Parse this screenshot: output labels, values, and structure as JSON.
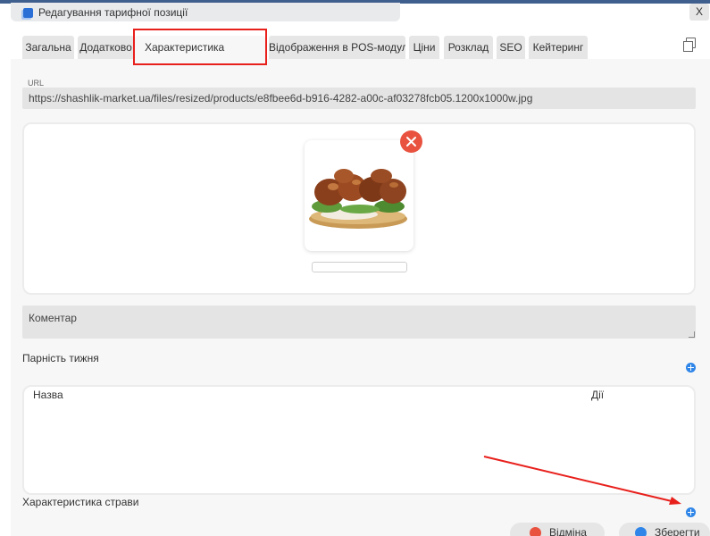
{
  "window": {
    "title": "Редагування тарифної позиції",
    "close_label": "X"
  },
  "tabs": [
    {
      "label": "Загальна"
    },
    {
      "label": "Додатково"
    },
    {
      "label": "Характеристика",
      "active": true
    },
    {
      "label": "Відображення в POS-модулі"
    },
    {
      "label": "Ціни"
    },
    {
      "label": "Розклад"
    },
    {
      "label": "SEO"
    },
    {
      "label": "Кейтеринг"
    }
  ],
  "url": {
    "label": "URL",
    "value": "https://shashlik-market.ua/files/resized/products/e8fbee6d-b916-4282-a00c-af03278fcb05.1200x1000w.jpg"
  },
  "comment": {
    "placeholder": "Коментар"
  },
  "week_parity": {
    "label": "Парність тижня"
  },
  "table": {
    "columns": [
      "Назва",
      "Дії"
    ]
  },
  "dish_characteristic": {
    "label": "Характеристика страви"
  },
  "buttons": {
    "cancel": "Відміна",
    "save": "Зберегти"
  },
  "colors": {
    "accent": "#2f86e8",
    "danger": "#e8523f",
    "annotation": "#e8201c"
  }
}
